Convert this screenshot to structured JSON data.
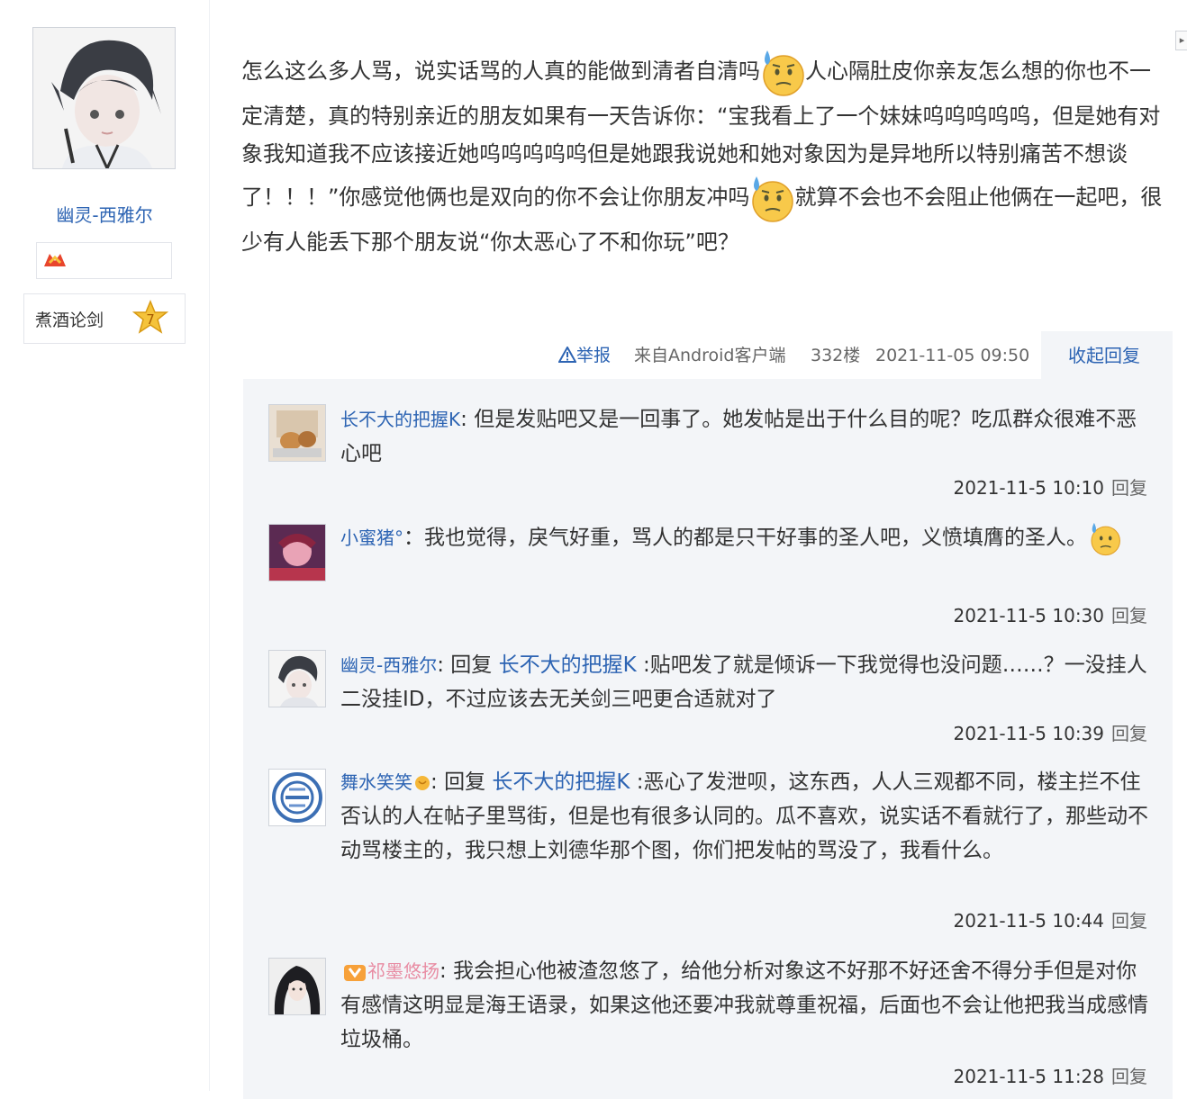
{
  "author": {
    "name": "幽灵-西雅尔",
    "level_name": "煮酒论剑",
    "level_number": "7"
  },
  "post": {
    "seg1": "怎么这么多人骂，说实话骂的人真的能做到清者自清吗",
    "seg2": "人心隔肚皮你亲友怎么想的你也不一定清楚，真的特别亲近的朋友如果有一天告诉你：“宝我看上了一个妹妹呜呜呜呜呜，但是她有对象我知道我不应该接近她呜呜呜呜呜但是她跟我说她和她对象因为是异地所以特别痛苦不想谈了！！！”你感觉他俩也是双向的你不会让你朋友冲吗",
    "seg3": "就算不会也不会阻止他俩在一起吧，很少有人能丢下那个朋友说“你太恶心了不和你玩”吧？",
    "report": "举报",
    "from": "来自Android客户端",
    "floor": "332楼",
    "time": "2021-11-05 09:50",
    "toggle": "收起回复"
  },
  "replies": [
    {
      "name": "长不大的把握K",
      "sep": ": ",
      "text": "但是发贴吧又是一回事了。她发帖是出于什么目的呢？吃瓜群众很难不恶心吧",
      "time": "2021-11-5 10:10",
      "reply_label": "回复"
    },
    {
      "name": "小蜜猪°",
      "sep": "：",
      "text": "我也觉得，戾气好重，骂人的都是只干好事的圣人吧，义愤填膺的圣人。",
      "time": "2021-11-5 10:30",
      "reply_label": "回复"
    },
    {
      "name": "幽灵-西雅尔",
      "sep": ": ",
      "reply_word": "回复 ",
      "ref": "长不大的把握K",
      "sep2": " :",
      "text": "贴吧发了就是倾诉一下我觉得也没问题……？一没挂人二没挂ID，不过应该去无关剑三吧更合适就对了",
      "time": "2021-11-5 10:39",
      "reply_label": "回复"
    },
    {
      "name": "舞水笑笑",
      "sep": ": ",
      "reply_word": "回复 ",
      "ref": "长不大的把握K",
      "sep2": " :",
      "text": "恶心了发泄呗，这东西，人人三观都不同，楼主拦不住否认的人在帖子里骂街，但是也有很多认同的。瓜不喜欢，说实话不看就行了，那些动不动骂楼主的，我只想上刘德华那个图，你们把发帖的骂没了，我看什么。",
      "time": "2021-11-5 10:44",
      "reply_label": "回复"
    },
    {
      "name": "祁墨悠扬",
      "sep": ": ",
      "text": "我会担心他被渣忽悠了，给他分析对象这不好那不好还舍不得分手但是对你有感情这明显是海王语录，如果这他还要冲我就尊重祝福，后面也不会让他把我当成感情垃圾桶。",
      "time": "2021-11-5 11:28",
      "reply_label": "回复"
    }
  ],
  "colors": {
    "link": "#2d64b3",
    "reply_bg": "#f3f5f8",
    "vip_name": "#e88ca3"
  },
  "icons": [
    "user-avatar-icon",
    "medal-icon",
    "level-star-icon",
    "warning-icon",
    "sweat-emoji-icon",
    "vip-icon"
  ]
}
